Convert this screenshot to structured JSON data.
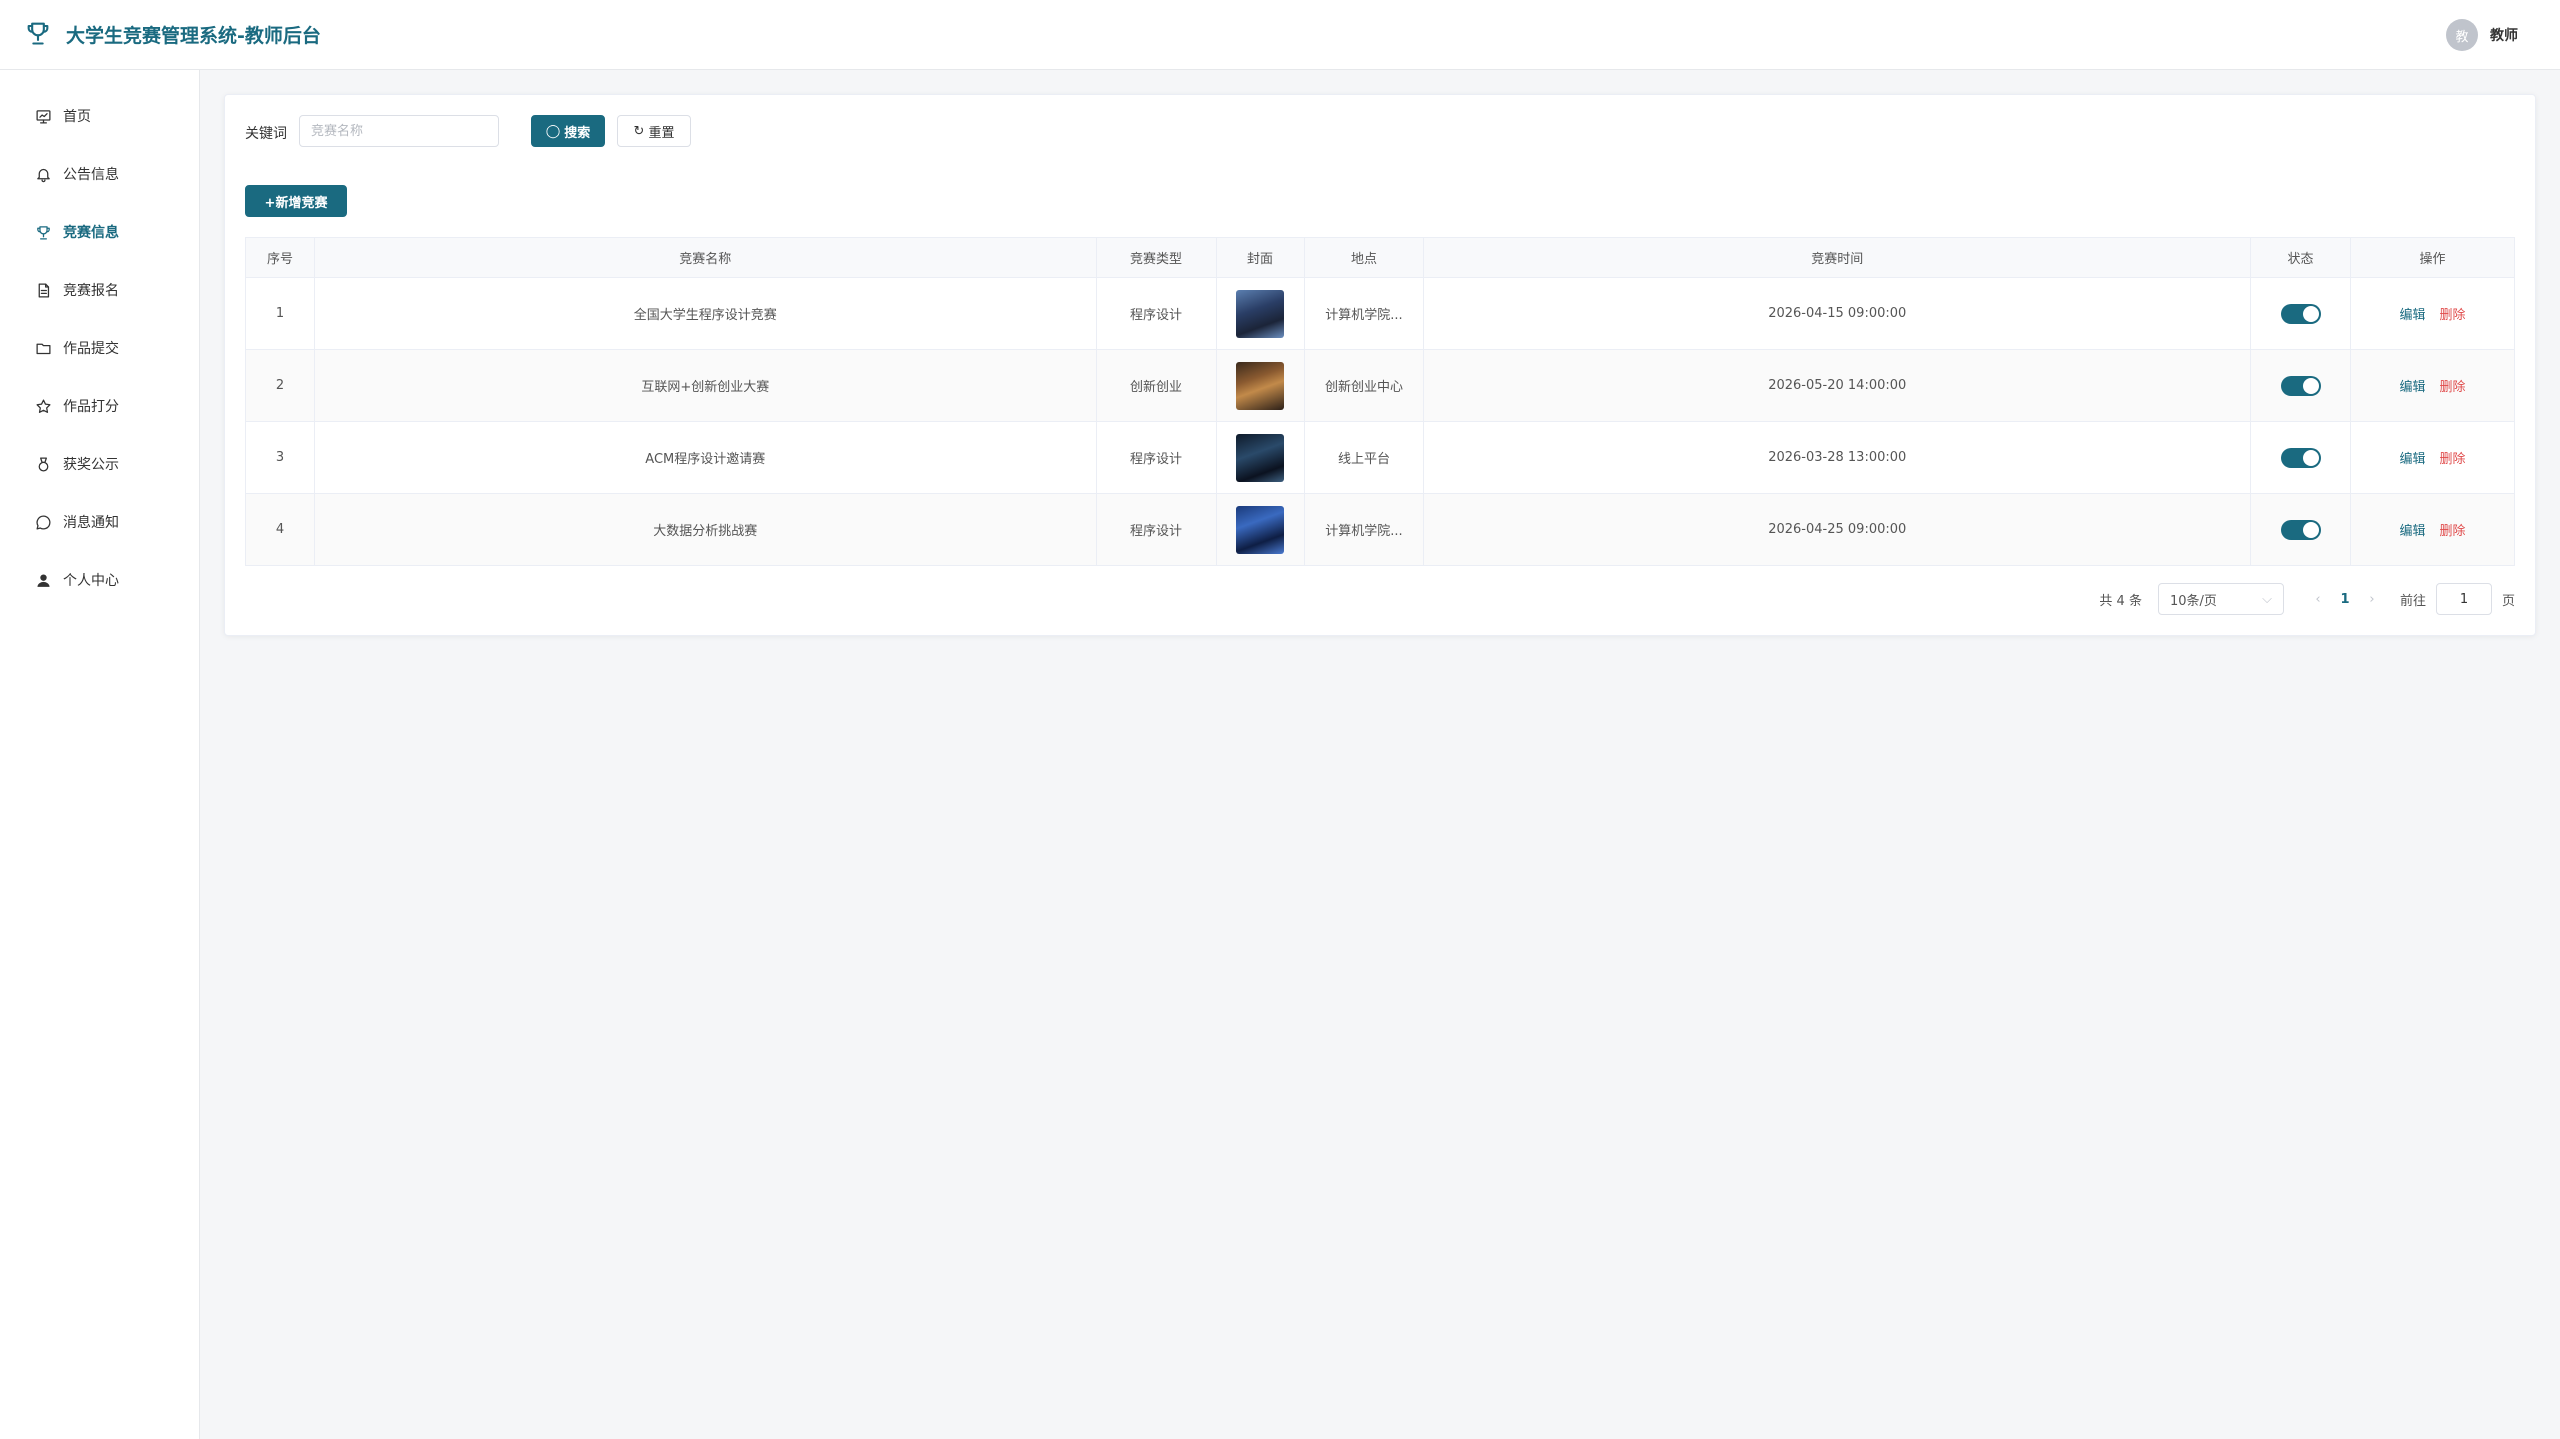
{
  "header": {
    "title": "大学生竞赛管理系统-教师后台",
    "user": {
      "avatar_text": "教",
      "name": "教师"
    }
  },
  "sidebar": {
    "items": [
      {
        "label": "首页",
        "icon": "home-icon"
      },
      {
        "label": "公告信息",
        "icon": "bell-icon"
      },
      {
        "label": "竞赛信息",
        "icon": "trophy-icon",
        "active": true
      },
      {
        "label": "竞赛报名",
        "icon": "document-icon"
      },
      {
        "label": "作品提交",
        "icon": "folder-icon"
      },
      {
        "label": "作品打分",
        "icon": "star-icon"
      },
      {
        "label": "获奖公示",
        "icon": "medal-icon"
      },
      {
        "label": "消息通知",
        "icon": "chat-icon"
      },
      {
        "label": "个人中心",
        "icon": "user-icon"
      }
    ]
  },
  "search": {
    "label": "关键词",
    "placeholder": "竞赛名称",
    "value": "",
    "search_button": "搜索",
    "reset_button": "重置"
  },
  "toolbar": {
    "add_button": "+新增竞赛"
  },
  "table": {
    "columns": [
      "序号",
      "竞赛名称",
      "竞赛类型",
      "封面",
      "地点",
      "竞赛时间",
      "状态",
      "操作"
    ],
    "rows": [
      {
        "index": "1",
        "name": "全国大学生程序设计竞赛",
        "type": "程序设计",
        "location": "计算机学院...",
        "time": "2026-04-15 09:00:00",
        "enabled": true,
        "edit": "编辑",
        "delete": "删除"
      },
      {
        "index": "2",
        "name": "互联网+创新创业大赛",
        "type": "创新创业",
        "location": "创新创业中心",
        "time": "2026-05-20 14:00:00",
        "enabled": true,
        "edit": "编辑",
        "delete": "删除"
      },
      {
        "index": "3",
        "name": "ACM程序设计邀请赛",
        "type": "程序设计",
        "location": "线上平台",
        "time": "2026-03-28 13:00:00",
        "enabled": true,
        "edit": "编辑",
        "delete": "删除"
      },
      {
        "index": "4",
        "name": "大数据分析挑战赛",
        "type": "程序设计",
        "location": "计算机学院...",
        "time": "2026-04-25 09:00:00",
        "enabled": true,
        "edit": "编辑",
        "delete": "删除"
      }
    ]
  },
  "pagination": {
    "total_text": "共 4 条",
    "page_size": "10条/页",
    "current_page": "1",
    "goto_label": "前往",
    "goto_value": "1",
    "goto_suffix": "页"
  },
  "colors": {
    "primary": "#1a6a80",
    "danger": "#e04a4a"
  }
}
